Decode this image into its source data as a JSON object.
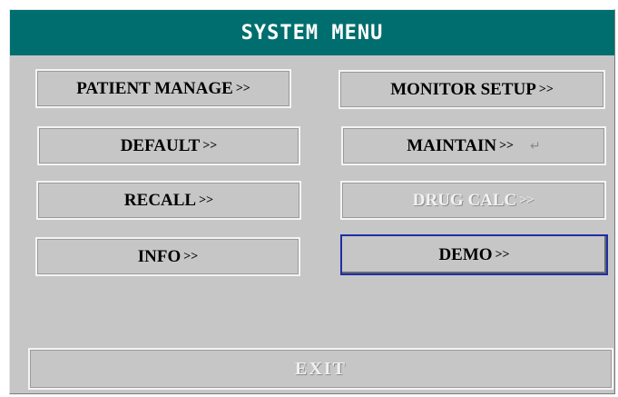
{
  "window": {
    "title": "SYSTEM MENU"
  },
  "menu": {
    "patient_manage": {
      "label": "PATIENT MANAGE",
      "arrow": ">>"
    },
    "monitor_setup": {
      "label": "MONITOR SETUP",
      "arrow": ">>"
    },
    "default": {
      "label": "DEFAULT",
      "arrow": ">>"
    },
    "maintain": {
      "label": "MAINTAIN",
      "arrow": ">>",
      "icon": "enter-return-icon",
      "icon_glyph": "↵"
    },
    "recall": {
      "label": "RECALL",
      "arrow": ">>"
    },
    "drug_calc": {
      "label": "DRUG CALC",
      "arrow": ">>",
      "state": "disabled"
    },
    "info": {
      "label": "INFO",
      "arrow": ">>"
    },
    "demo": {
      "label": "DEMO",
      "arrow": ">>",
      "state": "selected"
    }
  },
  "footer": {
    "exit_label": "EXIT"
  },
  "colors": {
    "title_bar": "#006e6e",
    "panel": "#c6c6c6",
    "selection_border": "#1e2fa8"
  }
}
